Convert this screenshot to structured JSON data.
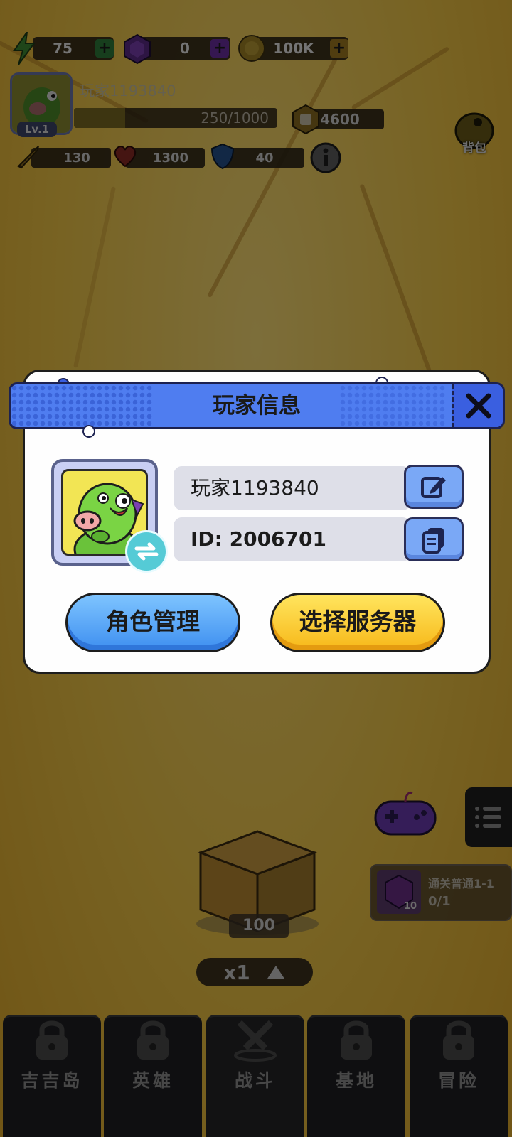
{
  "resources": {
    "energy": {
      "value": "75",
      "icon": "lightning-icon"
    },
    "gems": {
      "value": "0",
      "icon": "gem-icon"
    },
    "coins": {
      "value": "100K",
      "icon": "coin-icon"
    }
  },
  "player": {
    "name": "玩家1193840",
    "level": "Lv.1",
    "xp_text": "250/1000",
    "xp_fraction": 0.25,
    "power": "4600",
    "attack": "130",
    "hp": "1300",
    "defense": "40"
  },
  "bag": {
    "label": "背包"
  },
  "dialog": {
    "title": "玩家信息",
    "name": "玩家1193840",
    "id_text": "ID: 2006701",
    "role_button": "角色管理",
    "server_button": "选择服务器"
  },
  "quest": {
    "title": "通关普通1-1",
    "progress": "0/1",
    "reward_count": "10"
  },
  "chest": {
    "count": "100"
  },
  "multiplier": {
    "label": "x1"
  },
  "nav": {
    "items": [
      {
        "label": "吉吉岛",
        "icon": "lock-icon"
      },
      {
        "label": "英雄",
        "icon": "lock-icon"
      },
      {
        "label": "战斗",
        "icon": "crossed-swords-icon"
      },
      {
        "label": "基地",
        "icon": "lock-icon"
      },
      {
        "label": "冒险",
        "icon": "lock-icon"
      }
    ]
  },
  "colors": {
    "header_blue": "#4f7df0",
    "button_blue": "#3e8ff0",
    "button_yellow": "#f7b819",
    "background": "#f0c646"
  }
}
